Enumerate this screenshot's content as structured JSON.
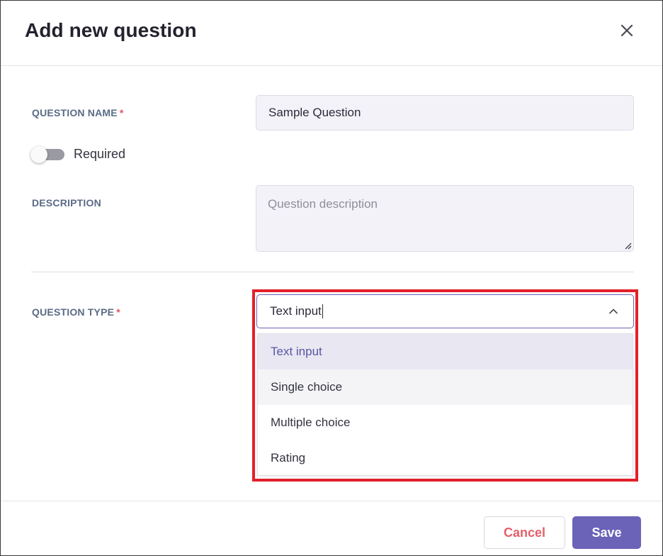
{
  "dialog": {
    "title": "Add new question",
    "close_icon": "close-icon"
  },
  "question_name": {
    "label": "QUESTION NAME",
    "required_mark": "*",
    "value": "Sample Question"
  },
  "required_toggle": {
    "label": "Required",
    "checked": false
  },
  "description": {
    "label": "DESCRIPTION",
    "placeholder": "Question description",
    "value": ""
  },
  "question_type": {
    "label": "QUESTION TYPE",
    "required_mark": "*",
    "selected_value": "Text input",
    "dropdown_open": true,
    "chevron_icon": "chevron-up-icon",
    "options": [
      {
        "label": "Text input",
        "selected": true
      },
      {
        "label": "Single choice",
        "hovered": true
      },
      {
        "label": "Multiple choice"
      },
      {
        "label": "Rating"
      }
    ]
  },
  "footer": {
    "cancel_label": "Cancel",
    "save_label": "Save"
  },
  "colors": {
    "accent": "#6a63b8",
    "cancel_text": "#e4606a",
    "required_star": "#e05561",
    "label": "#5a6b86",
    "highlight_border": "#e3202a"
  }
}
